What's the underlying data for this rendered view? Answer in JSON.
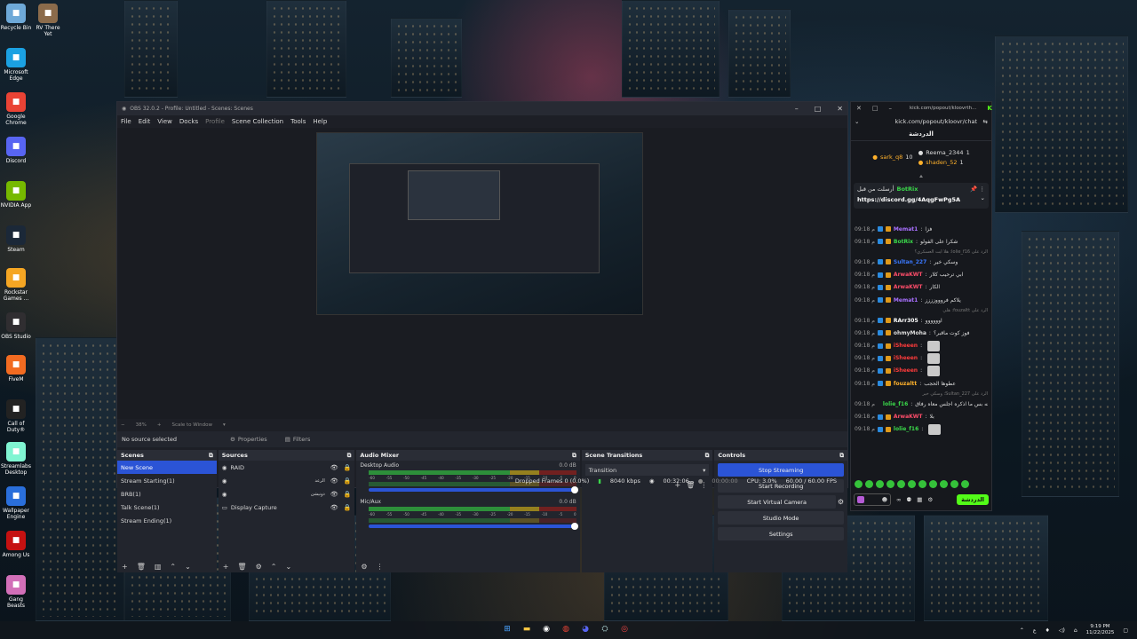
{
  "desktop": {
    "icons": [
      {
        "label": "Recycle Bin",
        "icon": "recycle-bin-icon",
        "color": "#6ea9d8"
      },
      {
        "label": "RV There Yet",
        "icon": "game-icon",
        "color": "#8b6b4b"
      },
      {
        "label": "Microsoft Edge",
        "icon": "edge-icon",
        "color": "#1ba1e2"
      },
      {
        "label": "Google Chrome",
        "icon": "chrome-icon",
        "color": "#e94335"
      },
      {
        "label": "Discord",
        "icon": "discord-icon",
        "color": "#5865f2"
      },
      {
        "label": "NVIDIA App",
        "icon": "nvidia-icon",
        "color": "#76b900"
      },
      {
        "label": "Steam",
        "icon": "steam-icon",
        "color": "#1b2838"
      },
      {
        "label": "Rockstar Games ...",
        "icon": "rockstar-icon",
        "color": "#f5a623"
      },
      {
        "label": "OBS Studio",
        "icon": "obs-icon",
        "color": "#302e31"
      },
      {
        "label": "FiveM",
        "icon": "fivem-icon",
        "color": "#f26b21"
      },
      {
        "label": "Call of Duty®",
        "icon": "cod-icon",
        "color": "#222222"
      },
      {
        "label": "Streamlabs Desktop",
        "icon": "streamlabs-icon",
        "color": "#80f5d2"
      },
      {
        "label": "Wallpaper Engine",
        "icon": "wallpaper-engine-icon",
        "color": "#2a6fdb"
      },
      {
        "label": "Among Us",
        "icon": "among-us-icon",
        "color": "#c51111"
      },
      {
        "label": "Gang Beasts",
        "icon": "gang-beasts-icon",
        "color": "#d26fb8"
      }
    ]
  },
  "obs": {
    "title": "OBS 32.0.2 - Profile: Untitled - Scenes: Scenes",
    "menu": [
      "File",
      "Edit",
      "View",
      "Docks",
      "Profile",
      "Scene Collection",
      "Tools",
      "Help"
    ],
    "zoom": "38%",
    "scale_mode": "Scale to Window",
    "no_source": "No source selected",
    "properties": "Properties",
    "filters": "Filters",
    "scenes": {
      "title": "Scenes",
      "items": [
        "New Scene",
        "Stream Starting(1)",
        "BRB(1)",
        "Talk Scene(1)",
        "Stream Ending(1)"
      ]
    },
    "sources": {
      "title": "Sources",
      "items": [
        {
          "name": "RAID",
          "label": ""
        },
        {
          "name": "",
          "label": "الرعد"
        },
        {
          "name": "",
          "label": "دونيشن"
        },
        {
          "name": "Display Capture",
          "label": ""
        }
      ]
    },
    "mixer": {
      "title": "Audio Mixer",
      "channels": [
        {
          "name": "Desktop Audio",
          "db": "0.0 dB"
        },
        {
          "name": "Mic/Aux",
          "db": "0.0 dB"
        }
      ],
      "ticks": [
        "-60",
        "-55",
        "-50",
        "-45",
        "-40",
        "-35",
        "-30",
        "-25",
        "-20",
        "-15",
        "-10",
        "-5",
        "0"
      ]
    },
    "transitions": {
      "title": "Scene Transitions",
      "value": "Transition"
    },
    "controls": {
      "title": "Controls",
      "buttons": [
        "Stop Streaming",
        "Start Recording",
        "Start Virtual Camera",
        "Studio Mode",
        "Settings"
      ]
    },
    "status": {
      "dropped": "Dropped Frames 0 (0.0%)",
      "bitrate": "8040 kbps",
      "stream_time": "00:32:06",
      "rec_time": "00:00:00",
      "cpu": "CPU: 3.0%",
      "fps": "60.00 / 60.00 FPS"
    }
  },
  "chat": {
    "url": "kick.com/popout/kloovr/chat",
    "url_short": "kick.com/popout/kloovrth...",
    "channel_label": "الدردشة",
    "gifters": [
      {
        "name": "sark_q8",
        "count": "10"
      },
      {
        "name": "Reema_2344",
        "count": "1"
      },
      {
        "name": "shaden_52",
        "count": "1"
      }
    ],
    "pinned": {
      "by": "أرسلت من قبل",
      "user": "BotRix",
      "link": "https://discord.gg/4AqgFwPg5A"
    },
    "messages": [
      {
        "time": "09:18 م",
        "user": "Memat1",
        "color": "#a970ff",
        "text": "فزا"
      },
      {
        "time": "09:18 م",
        "user": "BotRix",
        "color": "#3ad94a",
        "text": "شكرا على الفولو"
      },
      {
        "small": "الرد على lolie_f16: هلا ايت العسكري؟"
      },
      {
        "time": "09:18 م",
        "user": "Sultan_227",
        "color": "#3a78ff",
        "text": "وسكي خير"
      },
      {
        "time": "09:18 م",
        "user": "ArwaKWT",
        "color": "#ff4d6a",
        "text": "ابي ترحيب كلار"
      },
      {
        "time": "09:18 م",
        "user": "ArwaKWT",
        "color": "#ff4d6a",
        "text": "الكار"
      },
      {
        "time": "09:18 م",
        "user": "Memat1",
        "color": "#a970ff",
        "text": "يلاكم فروووزززز"
      },
      {
        "small": "الرد على fouzaltt: هلي"
      },
      {
        "time": "09:18 م",
        "user": "RArr305",
        "color": "#ffffff",
        "text": "اوووووو"
      },
      {
        "time": "09:18 م",
        "user": "ohmyMoha",
        "color": "#dddddd",
        "text": "فوز كوت ماقبر؟"
      },
      {
        "time": "09:18 م",
        "user": "iSheeen",
        "color": "#ff3b3b",
        "text": ""
      },
      {
        "time": "09:18 م",
        "user": "iSheeen",
        "color": "#ff3b3b",
        "text": ""
      },
      {
        "time": "09:18 م",
        "user": "iSheeen",
        "color": "#ff3b3b",
        "text": ""
      },
      {
        "time": "09:18 م",
        "user": "fouzaltt",
        "color": "#ffb12b",
        "text": "عطوها الحجب"
      },
      {
        "small": "الرد على Sultan_227: وسكي خير"
      },
      {
        "time": "09:18 م",
        "user": "lolie_f16",
        "color": "#3ad94a",
        "text": "اعرفه بس ما اذكره اجلس معاه رفاق"
      },
      {
        "time": "09:18 م",
        "user": "ArwaKWT",
        "color": "#ff4d6a",
        "text": "بلا"
      },
      {
        "time": "09:18 م",
        "user": "lolie_f16",
        "color": "#3ad94a",
        "text": ""
      }
    ],
    "footer_note": "المتابعين فقط",
    "chat_button": "الدردشة"
  },
  "taskbar": {
    "time": "9:19 PM",
    "date": "11/22/2025",
    "lang": "ع"
  }
}
